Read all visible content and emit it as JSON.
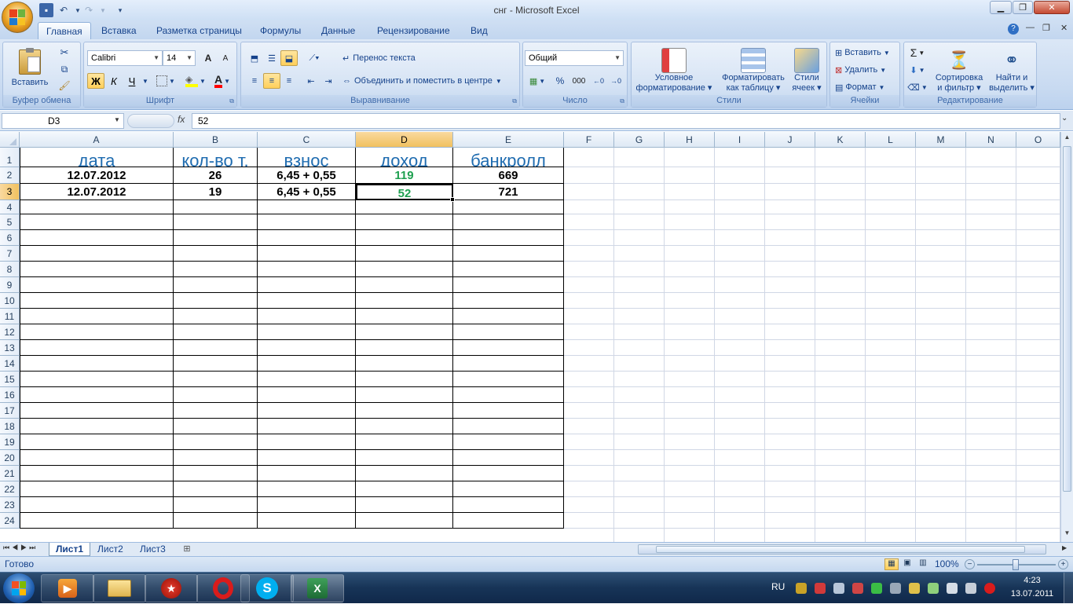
{
  "window": {
    "title": "снг - Microsoft Excel"
  },
  "tabs": [
    {
      "label": "Главная",
      "active": true
    },
    {
      "label": "Вставка"
    },
    {
      "label": "Разметка страницы"
    },
    {
      "label": "Формулы"
    },
    {
      "label": "Данные"
    },
    {
      "label": "Рецензирование"
    },
    {
      "label": "Вид"
    }
  ],
  "ribbon": {
    "clipboard": {
      "paste": "Вставить",
      "label": "Буфер обмена"
    },
    "font": {
      "name": "Calibri",
      "size": "14",
      "bold": "Ж",
      "italic": "К",
      "underline": "Ч",
      "grow": "A",
      "shrink": "A",
      "fontcolor": "A",
      "label": "Шрифт"
    },
    "alignment": {
      "wrap": "Перенос текста",
      "merge": "Объединить и поместить в центре",
      "label": "Выравнивание"
    },
    "number": {
      "format": "Общий",
      "percent": "%",
      "thousands": "000",
      "label": "Число"
    },
    "styles": {
      "conditional": "Условное",
      "conditional2": "форматирование",
      "table": "Форматировать",
      "table2": "как таблицу",
      "cell": "Стили",
      "cell2": "ячеек",
      "label": "Стили"
    },
    "cells": {
      "insert": "Вставить",
      "delete": "Удалить",
      "format": "Формат",
      "label": "Ячейки"
    },
    "editing": {
      "sigma": "Σ",
      "sort": "Сортировка",
      "sort2": "и фильтр",
      "find": "Найти и",
      "find2": "выделить",
      "label": "Редактирование"
    }
  },
  "formula_bar": {
    "name_box": "D3",
    "fx": "fx",
    "value": "52"
  },
  "columns": [
    "A",
    "B",
    "C",
    "D",
    "E",
    "F",
    "G",
    "H",
    "I",
    "J",
    "K",
    "L",
    "M",
    "N",
    "O"
  ],
  "rows": [
    "1",
    "2",
    "3",
    "4",
    "5",
    "6",
    "7",
    "8",
    "9",
    "10",
    "11",
    "12",
    "13",
    "14",
    "15",
    "16",
    "17",
    "18",
    "19",
    "20",
    "21",
    "22",
    "23",
    "24"
  ],
  "table": {
    "headers": [
      "дата",
      "кол-во т.",
      "взнос",
      "доход",
      "банкролл"
    ],
    "data": [
      [
        "12.07.2012",
        "26",
        "6,45 + 0,55",
        "119",
        "669"
      ],
      [
        "12.07.2012",
        "19",
        "6,45 + 0,55",
        "52",
        "721"
      ]
    ]
  },
  "sheets": [
    {
      "label": "Лист1",
      "active": true
    },
    {
      "label": "Лист2"
    },
    {
      "label": "Лист3"
    }
  ],
  "status": {
    "ready": "Готово",
    "zoom": "100%"
  },
  "taskbar": {
    "lang": "RU",
    "time": "4:23",
    "date": "13.07.2011"
  },
  "colors": {
    "header_text": "#1f6cb0",
    "income_text": "#1fa050",
    "selected_header": "#f1c15f"
  }
}
